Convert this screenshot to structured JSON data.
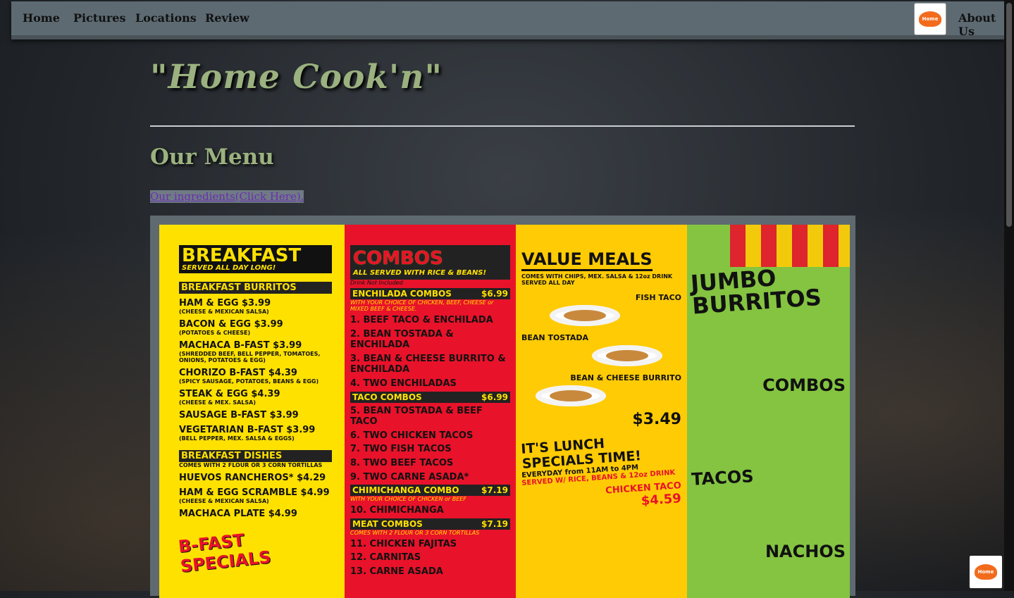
{
  "nav": {
    "items": [
      "Home",
      "Pictures",
      "Locations",
      "Review"
    ],
    "about_label": "About Us",
    "logo_text": "Home"
  },
  "page": {
    "title": "\"Home Cook'n\"",
    "menu_heading": "Our Menu",
    "ingredients_link": "Our ingredients(Click Here)."
  },
  "menu_image": {
    "breakfast": {
      "title": "BREAKFAST",
      "subtitle": "SERVED ALL DAY LONG!",
      "burritos_header": "BREAKFAST BURRITOS",
      "burritos": [
        {
          "name": "HAM & EGG  $3.99",
          "note": "(CHEESE & MEXICAN SALSA)"
        },
        {
          "name": "BACON & EGG  $3.99",
          "note": "(POTATOES & CHEESE)"
        },
        {
          "name": "MACHACA B-FAST  $3.99",
          "note": "(SHREDDED BEEF, BELL PEPPER, TOMATOES, ONIONS, POTATOES & EGG)"
        },
        {
          "name": "CHORIZO B-FAST  $4.39",
          "note": "(SPICY SAUSAGE, POTATOES, BEANS & EGG)"
        },
        {
          "name": "STEAK & EGG  $4.39",
          "note": "(CHEESE & MEX. SALSA)"
        },
        {
          "name": "SAUSAGE B-FAST  $3.99",
          "note": ""
        },
        {
          "name": "VEGETARIAN B-FAST  $3.99",
          "note": "(BELL PEPPER, MEX. SALSA & EGGS)"
        }
      ],
      "dishes_header": "BREAKFAST DISHES",
      "dishes_note": "COMES WITH 2 FLOUR OR 3 CORN TORTILLAS",
      "dishes": [
        {
          "name": "HUEVOS RANCHEROS*  $4.29",
          "note": ""
        },
        {
          "name": "HAM & EGG SCRAMBLE  $4.99",
          "note": "(CHEESE & MEXICAN SALSA)"
        },
        {
          "name": "MACHACA PLATE  $4.99",
          "note": ""
        }
      ],
      "specials": "B-FAST SPECIALS"
    },
    "combos": {
      "title": "COMBOS",
      "subtitle": "ALL SERVED WITH RICE & BEANS!",
      "drink_note": "Drink Not Included",
      "sections": [
        {
          "header": "ENCHILADA COMBOS",
          "price": "$6.99",
          "note": "WITH YOUR CHOICE OF CHICKEN, BEEF, CHEESE or MIXED BEEF & CHEESE.",
          "items": [
            "1. BEEF TACO & ENCHILADA",
            "2. BEAN TOSTADA & ENCHILADA",
            "3. BEAN & CHEESE BURRITO & ENCHILADA",
            "4. TWO ENCHILADAS"
          ]
        },
        {
          "header": "TACO COMBOS",
          "price": "$6.99",
          "note": "",
          "items": [
            "5. BEAN TOSTADA & BEEF TACO",
            "6. TWO CHICKEN TACOS",
            "7. TWO FISH TACOS",
            "8. TWO BEEF TACOS",
            "9. TWO CARNE ASADA*"
          ]
        },
        {
          "header": "CHIMICHANGA COMBO",
          "price": "$7.19",
          "note": "WITH YOUR CHOICE OF CHICKEN or BEEF",
          "items": [
            "10. CHIMICHANGA"
          ]
        },
        {
          "header": "MEAT COMBOS",
          "price": "$7.19",
          "note": "COMES WITH 2 FLOUR OR 3 CORN TORTILLAS",
          "items": [
            "11. CHICKEN FAJITAS",
            "12. CARNITAS",
            "13. CARNE ASADA"
          ]
        }
      ]
    },
    "value_meals": {
      "title": "VALUE MEALS",
      "subtitle": "COMES WITH CHIPS, MEX. SALSA & 12oz DRINK   SERVED ALL DAY",
      "items": [
        "FISH TACO",
        "BEAN TOSTADA",
        "BEAN & CHEESE BURRITO"
      ],
      "price": "$3.49",
      "lunch_title": "IT'S LUNCH SPECIALS TIME!",
      "lunch_hours": "EVERYDAY from 11AM to 4PM",
      "lunch_note": "SERVED W/ RICE, BEANS & 12oz DRINK",
      "lunch_item": "CHICKEN TACO",
      "lunch_price": "$4.59"
    },
    "jumbo": {
      "title": "JUMBO BURRITOS",
      "sections": [
        "COMBOS",
        "TACOS",
        "NACHOS"
      ]
    }
  },
  "colors": {
    "title_green": "#9bb17f",
    "nav_bg": "#5d6a72",
    "menu_yellow": "#ffe100",
    "menu_red": "#e8122a",
    "menu_green": "#84c441"
  },
  "icons": {
    "logo": "restaurant-logo-icon",
    "fab": "chat-logo-icon"
  }
}
